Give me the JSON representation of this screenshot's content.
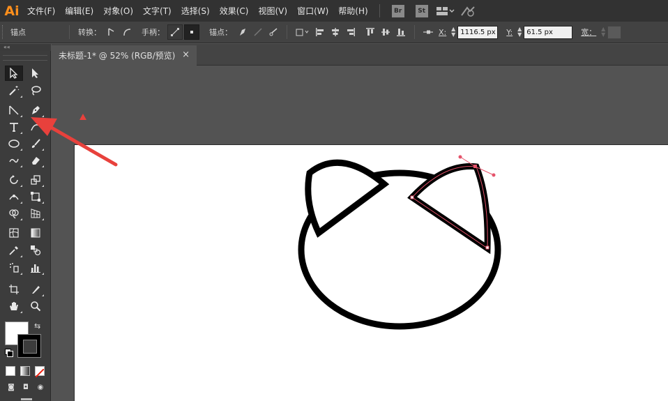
{
  "app": {
    "logo": "Ai"
  },
  "menu": [
    "文件(F)",
    "编辑(E)",
    "对象(O)",
    "文字(T)",
    "选择(S)",
    "效果(C)",
    "视图(V)",
    "窗口(W)",
    "帮助(H)"
  ],
  "menubar_badges": {
    "bridge": "Br",
    "stock": "St"
  },
  "control_bar": {
    "mode_label": "锚点",
    "convert_label": "转换：",
    "handles_label": "手柄：",
    "anchors_label": "锚点：",
    "x_label": "X:",
    "x_value": "1116.5 px",
    "y_label": "Y:",
    "y_value": "61.5 px",
    "width_label": "宽："
  },
  "document": {
    "tab_title": "未标题-1* @ 52% (RGB/预览)",
    "close_glyph": "×"
  },
  "colors": {
    "annotation_red": "#e8413c",
    "selection_path": "#e5536b",
    "ui_dark": "#323232",
    "canvas_bg": "#535353"
  },
  "icons": [
    "selection-icon",
    "direct-selection-icon",
    "magic-wand-icon",
    "lasso-icon",
    "line-segment-icon",
    "pen-icon",
    "type-icon",
    "curvature-icon",
    "ellipse-icon",
    "paintbrush-icon",
    "shaper-icon",
    "eraser-icon",
    "rotate-icon",
    "scale-icon",
    "width-icon",
    "free-transform-icon",
    "shape-builder-icon",
    "perspective-grid-icon",
    "mesh-icon",
    "gradient-icon",
    "eyedropper-icon",
    "blend-icon",
    "symbol-sprayer-icon",
    "column-graph-icon",
    "artboard-icon",
    "slice-icon",
    "hand-icon",
    "zoom-icon"
  ]
}
